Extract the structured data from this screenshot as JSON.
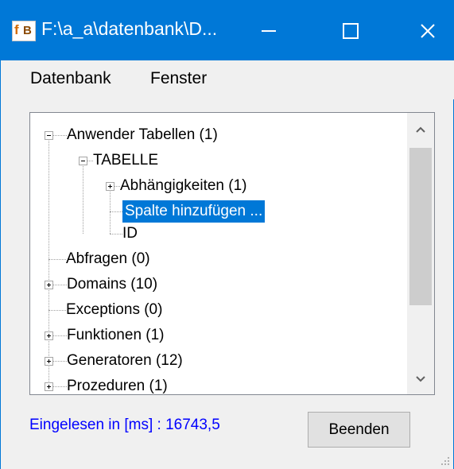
{
  "window": {
    "title": "F:\\a_a\\datenbank\\D...",
    "app_icon": "firebird-icon",
    "controls": {
      "minimize": "minimize-icon",
      "maximize": "maximize-icon",
      "close": "close-icon"
    }
  },
  "menu": {
    "items": [
      {
        "label": "Datenbank"
      },
      {
        "label": "Fenster"
      }
    ]
  },
  "tree": {
    "nodes": [
      {
        "label": "Anwender Tabellen (1)",
        "expander": "minus"
      },
      {
        "label": "TABELLE",
        "expander": "minus"
      },
      {
        "label": "Abhängigkeiten (1)",
        "expander": "plus"
      },
      {
        "label": "Spalte hinzufügen ...",
        "selected": true
      },
      {
        "label": "ID"
      },
      {
        "label": "Abfragen (0)"
      },
      {
        "label": "Domains (10)",
        "expander": "plus"
      },
      {
        "label": "Exceptions (0)"
      },
      {
        "label": "Funktionen (1)",
        "expander": "plus"
      },
      {
        "label": "Generatoren (12)",
        "expander": "plus"
      },
      {
        "label": "Prozeduren (1)",
        "expander": "plus"
      }
    ]
  },
  "status": {
    "text": "Eingelesen in [ms] : 16743,5",
    "color": "#0000ff"
  },
  "buttons": {
    "exit_label": "Beenden"
  },
  "colors": {
    "accent": "#0078d7",
    "selection": "#0078d7"
  }
}
